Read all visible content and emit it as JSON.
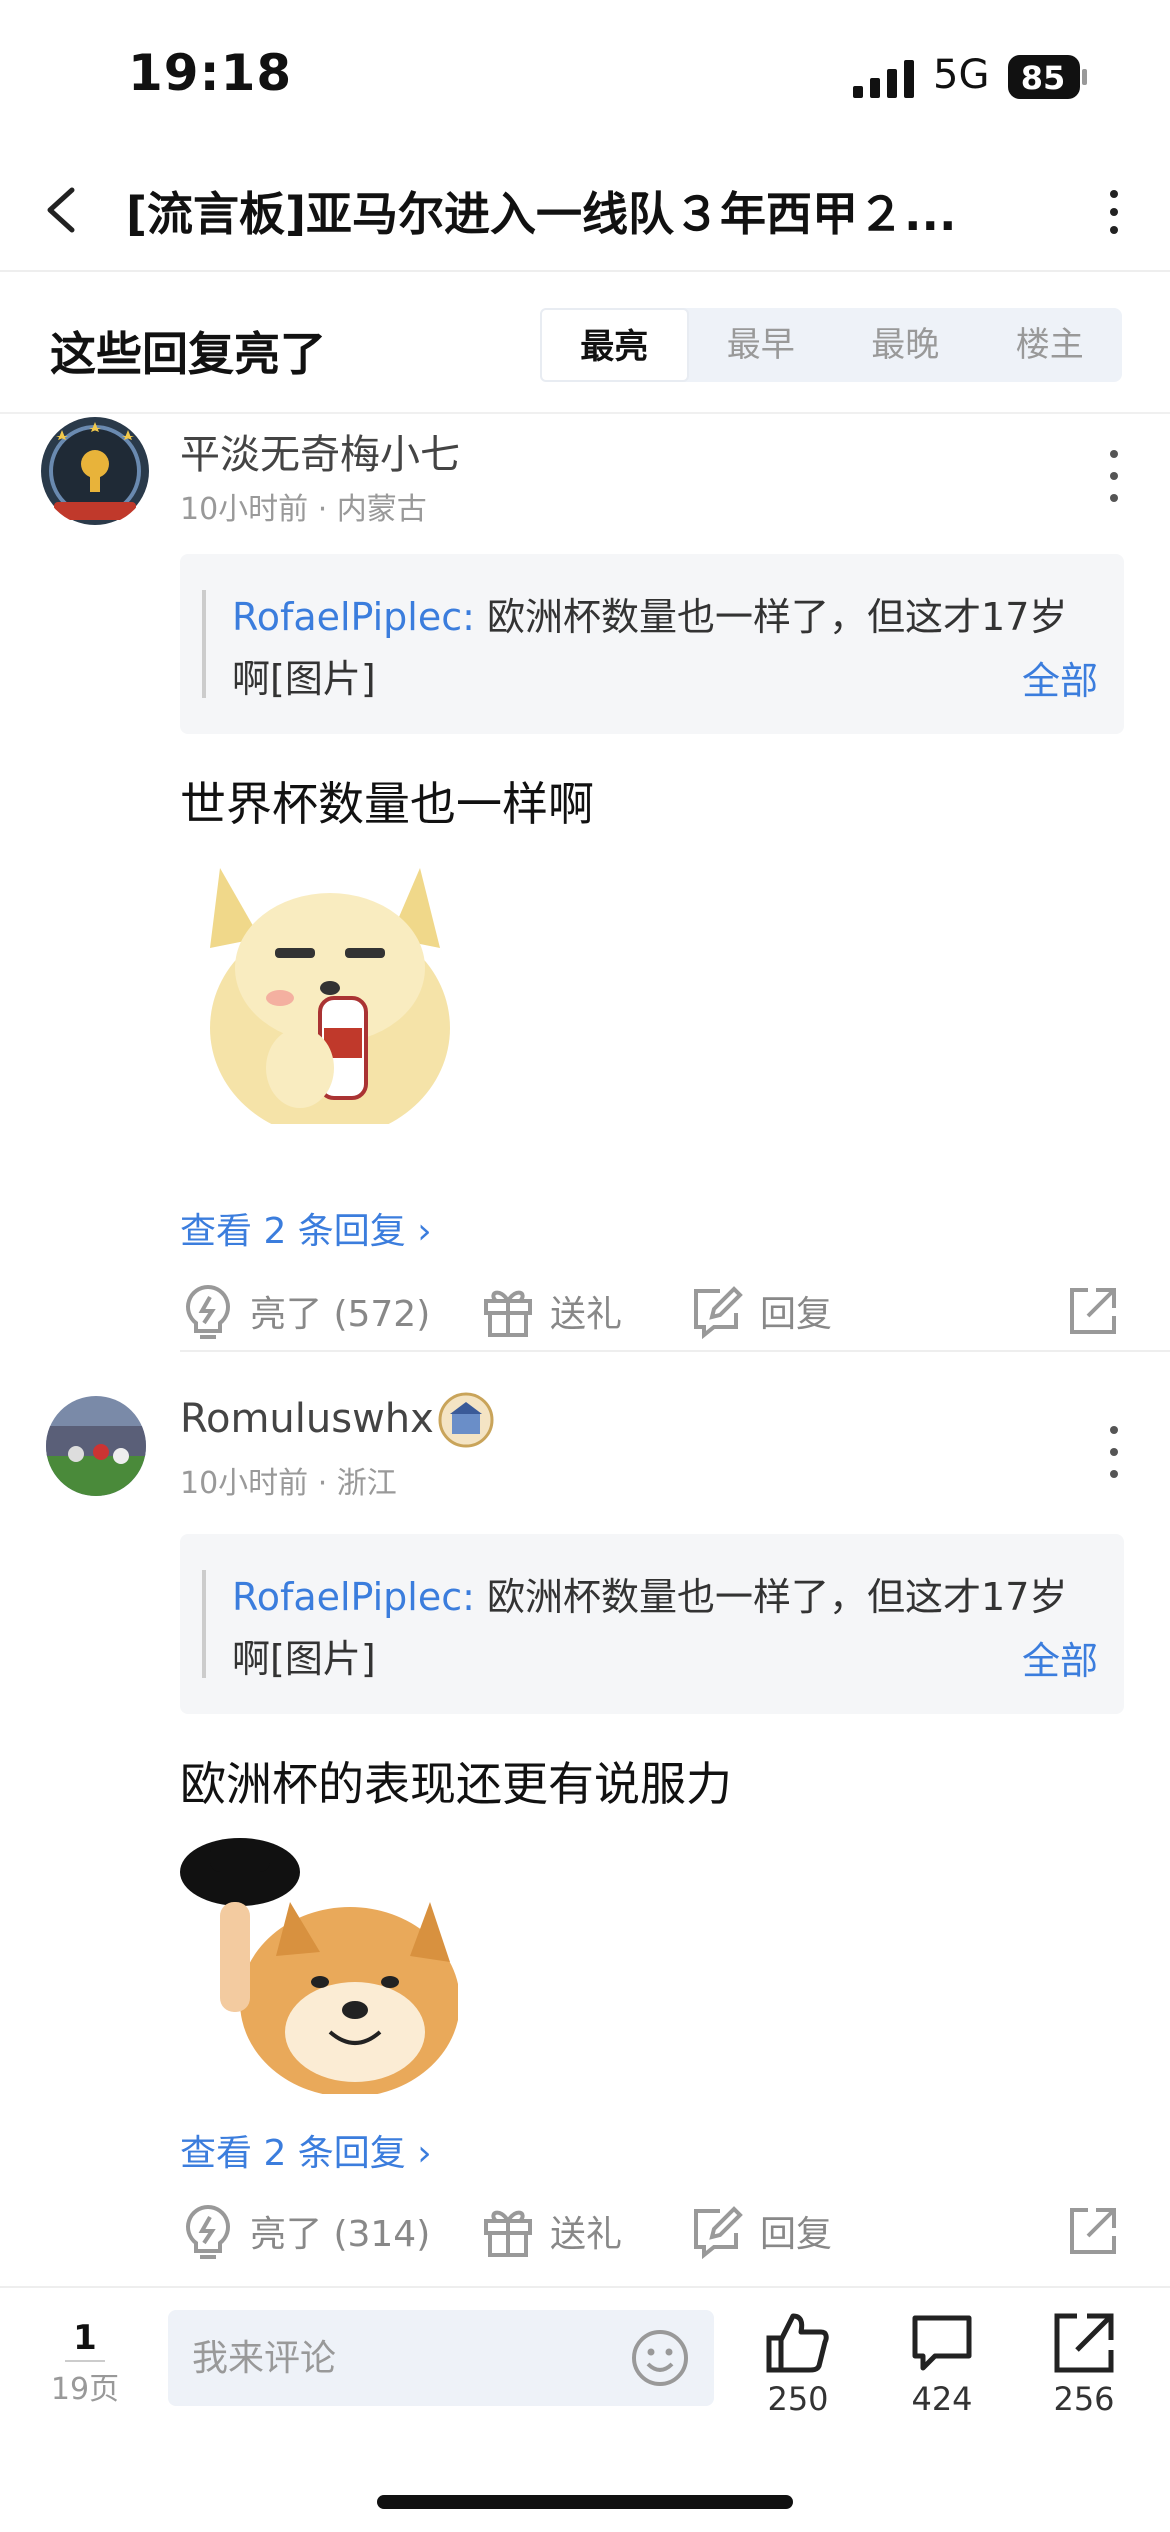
{
  "status": {
    "time": "19:18",
    "network": "5G",
    "battery": "85"
  },
  "nav": {
    "title": "[流言板]亚马尔进入一线队３年西甲２..."
  },
  "section": {
    "label": "这些回复亮了",
    "tabs": [
      "最亮",
      "最早",
      "最晚",
      "楼主"
    ],
    "active_tab": "最亮"
  },
  "comments": [
    {
      "username": "平淡无奇梅小七",
      "meta": "10小时前 · 内蒙古",
      "quote_name": "RofaelPiplec:",
      "quote_text": " 欧洲杯数量也一样了，但这才17岁啊[图片]",
      "quote_all": "全部",
      "text": "世界杯数量也一样啊",
      "view_replies": "查看 2 条回复",
      "like_label": "亮了 (572)",
      "gift_label": "送礼",
      "reply_label": "回复"
    },
    {
      "username": "Romuluswhx",
      "meta": "10小时前 · 浙江",
      "quote_name": "RofaelPiplec:",
      "quote_text": " 欧洲杯数量也一样了，但这才17岁啊[图片]",
      "quote_all": "全部",
      "text": "欧洲杯的表现还更有说服力",
      "view_replies": "查看 2 条回复",
      "like_label": "亮了 (314)",
      "gift_label": "送礼",
      "reply_label": "回复"
    }
  ],
  "bottom": {
    "page_current": "1",
    "page_total": "19页",
    "comment_placeholder": "我来评论",
    "like_count": "250",
    "comment_count": "424",
    "share_count": "256"
  },
  "colors": {
    "link": "#3b7ddd",
    "muted": "#999999",
    "input_bg": "#eef2f8"
  }
}
